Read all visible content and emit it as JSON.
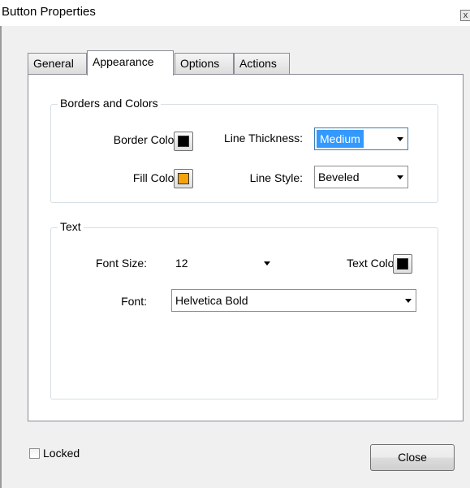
{
  "window": {
    "title": "Button Properties",
    "close_glyph": "x"
  },
  "tabs": [
    {
      "label": "General",
      "active": false
    },
    {
      "label": "Appearance",
      "active": true
    },
    {
      "label": "Options",
      "active": false
    },
    {
      "label": "Actions",
      "active": false
    }
  ],
  "borders_colors": {
    "heading": "Borders and Colors",
    "border_color_label": "Border Color:",
    "border_color_value": "#000000",
    "fill_color_label": "Fill Color:",
    "fill_color_value": "#f5a20b",
    "line_thickness_label": "Line Thickness:",
    "line_thickness_value": "Medium",
    "line_style_label": "Line Style:",
    "line_style_value": "Beveled"
  },
  "text_group": {
    "heading": "Text",
    "font_size_label": "Font Size:",
    "font_size_value": "12",
    "text_color_label": "Text Color:",
    "text_color_value": "#000000",
    "font_label": "Font:",
    "font_value": "Helvetica Bold"
  },
  "footer": {
    "locked_label": "Locked",
    "locked_checked": false,
    "close_label": "Close"
  },
  "icons": {
    "dropdown": "chevron-down-icon",
    "window_close": "close-icon"
  }
}
